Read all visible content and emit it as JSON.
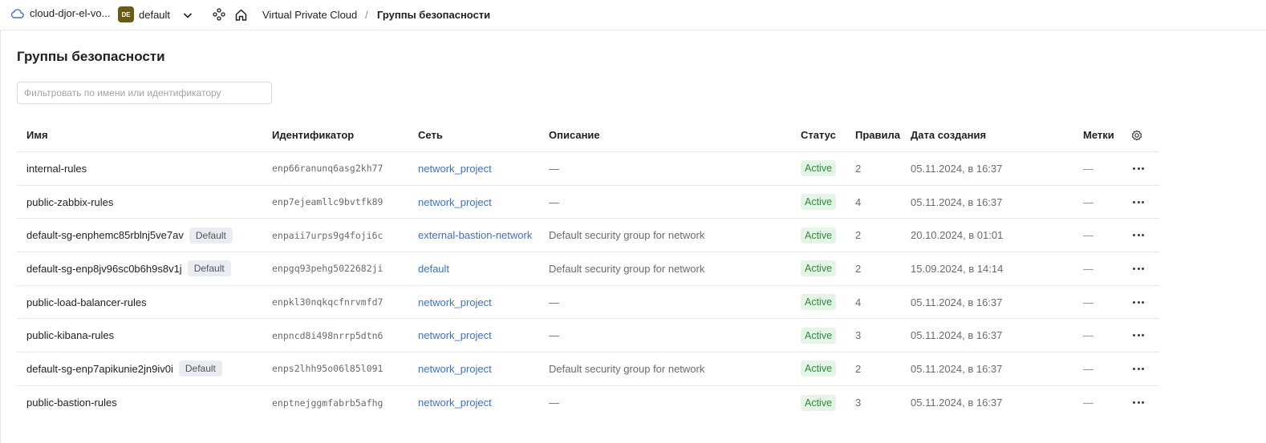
{
  "header": {
    "cloud_name": "cloud-djor-el-vo...",
    "folder_badge": "DE",
    "folder_name": "default",
    "breadcrumb_service": "Virtual Private Cloud",
    "breadcrumb_separator": "/",
    "breadcrumb_current": "Группы безопасности"
  },
  "page": {
    "title": "Группы безопасности",
    "filter_placeholder": "Фильтровать по имени или идентификатору"
  },
  "table": {
    "columns": {
      "name": "Имя",
      "id": "Идентификатор",
      "network": "Сеть",
      "description": "Описание",
      "status": "Статус",
      "rules": "Правила",
      "created": "Дата создания",
      "labels": "Метки"
    },
    "rows": [
      {
        "name": "internal-rules",
        "badge": "",
        "id": "enp66ranunq6asg2kh77",
        "network": "network_project",
        "description": "—",
        "status": "Active",
        "rules": "2",
        "created": "05.11.2024, в 16:37",
        "labels": "—"
      },
      {
        "name": "public-zabbix-rules",
        "badge": "",
        "id": "enp7ejeamllc9bvtfk89",
        "network": "network_project",
        "description": "—",
        "status": "Active",
        "rules": "4",
        "created": "05.11.2024, в 16:37",
        "labels": "—"
      },
      {
        "name": "default-sg-enphemc85rblnj5ve7av",
        "badge": "Default",
        "id": "enpaii7urps9g4foji6c",
        "network": "external-bastion-network",
        "description": "Default security group for network",
        "status": "Active",
        "rules": "2",
        "created": "20.10.2024, в 01:01",
        "labels": "—"
      },
      {
        "name": "default-sg-enp8jv96sc0b6h9s8v1j",
        "badge": "Default",
        "id": "enpgq93pehg5022682ji",
        "network": "default",
        "description": "Default security group for network",
        "status": "Active",
        "rules": "2",
        "created": "15.09.2024, в 14:14",
        "labels": "—"
      },
      {
        "name": "public-load-balancer-rules",
        "badge": "",
        "id": "enpkl30nqkqcfnrvmfd7",
        "network": "network_project",
        "description": "—",
        "status": "Active",
        "rules": "4",
        "created": "05.11.2024, в 16:37",
        "labels": "—"
      },
      {
        "name": "public-kibana-rules",
        "badge": "",
        "id": "enpncd8i498nrrp5dtn6",
        "network": "network_project",
        "description": "—",
        "status": "Active",
        "rules": "3",
        "created": "05.11.2024, в 16:37",
        "labels": "—"
      },
      {
        "name": "default-sg-enp7apikunie2jn9iv0i",
        "badge": "Default",
        "id": "enps2lhh95o06l85l091",
        "network": "network_project",
        "description": "Default security group for network",
        "status": "Active",
        "rules": "2",
        "created": "05.11.2024, в 16:37",
        "labels": "—"
      },
      {
        "name": "public-bastion-rules",
        "badge": "",
        "id": "enptnejggmfabrb5afhg",
        "network": "network_project",
        "description": "—",
        "status": "Active",
        "rules": "3",
        "created": "05.11.2024, в 16:37",
        "labels": "—"
      }
    ]
  },
  "icons": {
    "cloud": "cloud-icon",
    "chevron": "chevron-down-icon",
    "service": "vpc-service-icon",
    "home": "home-icon",
    "settings": "gear-icon",
    "row_menu": "more-horizontal-icon"
  },
  "colors": {
    "link": "#3b6fd6",
    "status_bg": "#e5f5e5",
    "status_text": "#2b8a3e",
    "folder_badge": "#6a5a14"
  }
}
